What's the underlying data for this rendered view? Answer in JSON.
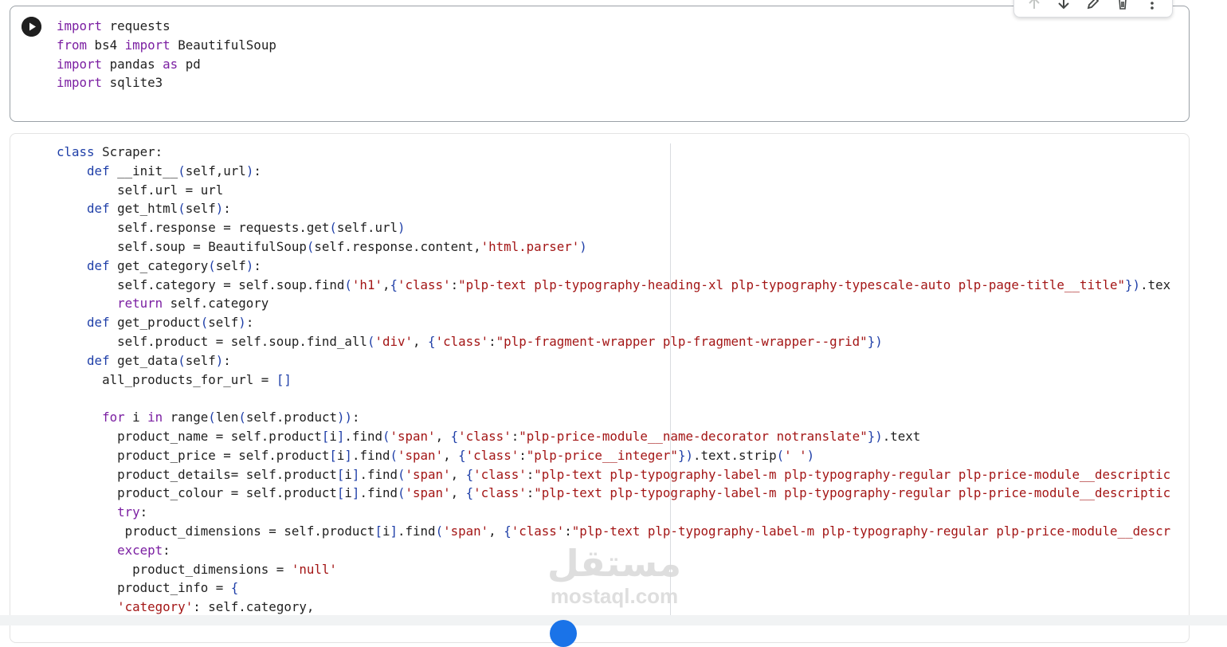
{
  "toolbar": {
    "items": [
      "arrow-up-icon",
      "arrow-down-icon",
      "pencil-icon",
      "trash-icon",
      "more-vert-icon"
    ]
  },
  "cells": [
    {
      "lines": [
        "import requests",
        "from bs4 import BeautifulSoup",
        "import pandas as pd",
        "import sqlite3"
      ]
    },
    {
      "lines": [
        "class Scraper:",
        "    def __init__(self,url):",
        "        self.url = url",
        "    def get_html(self):",
        "        self.response = requests.get(self.url)",
        "        self.soup = BeautifulSoup(self.response.content,'html.parser')",
        "    def get_category(self):",
        "        self.category = self.soup.find('h1',{'class':\"plp-text plp-typography-heading-xl plp-typography-typescale-auto plp-page-title__title\"}).tex",
        "        return self.category",
        "    def get_product(self):",
        "        self.product = self.soup.find_all('div', {'class':\"plp-fragment-wrapper plp-fragment-wrapper--grid\"})",
        "    def get_data(self):",
        "      all_products_for_url = []",
        "",
        "      for i in range(len(self.product)):",
        "        product_name = self.product[i].find('span', {'class':\"plp-price-module__name-decorator notranslate\"}).text",
        "        product_price = self.product[i].find('span', {'class':\"plp-price__integer\"}).text.strip(' ')",
        "        product_details= self.product[i].find('span', {'class':\"plp-text plp-typography-label-m plp-typography-regular plp-price-module__descriptic",
        "        product_colour = self.product[i].find('span', {'class':\"plp-text plp-typography-label-m plp-typography-regular plp-price-module__descriptic",
        "        try:",
        "         product_dimensions = self.product[i].find('span', {'class':\"plp-text plp-typography-label-m plp-typography-regular plp-price-module__descr",
        "        except:",
        "          product_dimensions = 'null'",
        "        product_info = {",
        "        'category': self.category,"
      ]
    }
  ],
  "watermark": {
    "arabic": "مستقل",
    "latin": "mostaql.com"
  },
  "colors": {
    "keyword": "#7b1fa2",
    "def_keyword": "#1f3fa8",
    "string": "#a31515",
    "bracket": "#1f3fa8"
  }
}
